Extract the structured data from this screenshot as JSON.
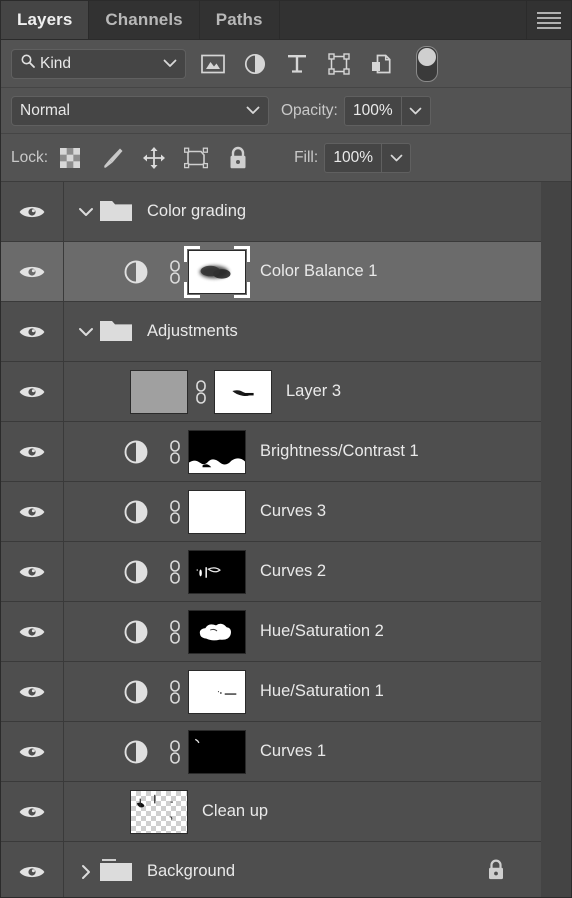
{
  "panel": {
    "tabs": [
      {
        "label": "Layers",
        "active": true
      },
      {
        "label": "Channels",
        "active": false
      },
      {
        "label": "Paths",
        "active": false
      }
    ],
    "menu_icon": "hamburger-menu-icon"
  },
  "filter": {
    "kind_label": "Kind",
    "search_icon": "search-icon",
    "chevron": "chevron-down-icon",
    "icons": [
      "pixel-layer-filter-icon",
      "adjustment-layer-filter-icon",
      "type-layer-filter-icon",
      "shape-layer-filter-icon",
      "smart-object-filter-icon",
      "filter-toggle-switch"
    ]
  },
  "blend": {
    "mode": "Normal",
    "opacity_label": "Opacity:",
    "opacity_value": "100%"
  },
  "lock": {
    "label": "Lock:",
    "fill_label": "Fill:",
    "fill_value": "100%",
    "icons": [
      "lock-transparent-pixels-icon",
      "lock-image-pixels-icon",
      "lock-position-icon",
      "lock-artboard-nesting-icon",
      "lock-all-icon"
    ]
  },
  "colors": {
    "panel_bg": "#535353",
    "row_bg": "#4e4e4e",
    "row_selected_bg": "#6b6b6b",
    "tab_active_bg": "#454545",
    "tabbar_bg": "#323232",
    "text": "#e9e9e9",
    "gutter": "#444444"
  },
  "layers": [
    {
      "name": "Color grading",
      "type": "group",
      "visible": true,
      "selected": false,
      "expanded": true,
      "indent": 0,
      "locked": false
    },
    {
      "name": "Color Balance 1",
      "type": "adjustment",
      "visible": true,
      "selected": true,
      "indent": 1,
      "linked": true,
      "mask": "blurred-dark-blob-on-white",
      "locked": false
    },
    {
      "name": "Adjustments",
      "type": "group",
      "visible": true,
      "selected": false,
      "expanded": true,
      "indent": 0,
      "locked": false
    },
    {
      "name": "Layer 3",
      "type": "pixel",
      "visible": true,
      "selected": false,
      "indent": 1,
      "linked": true,
      "mask": "white-with-small-dark-streak",
      "locked": false
    },
    {
      "name": "Brightness/Contrast 1",
      "type": "adjustment",
      "visible": true,
      "selected": false,
      "indent": 1,
      "linked": true,
      "mask": "black-with-white-bottom-band",
      "locked": false
    },
    {
      "name": "Curves 3",
      "type": "adjustment",
      "visible": true,
      "selected": false,
      "indent": 1,
      "linked": true,
      "mask": "all-white",
      "locked": false
    },
    {
      "name": "Curves 2",
      "type": "adjustment",
      "visible": true,
      "selected": false,
      "indent": 1,
      "linked": true,
      "mask": "black-with-small-white-marks",
      "locked": false
    },
    {
      "name": "Hue/Saturation 2",
      "type": "adjustment",
      "visible": true,
      "selected": false,
      "indent": 1,
      "linked": true,
      "mask": "black-with-white-blob",
      "locked": false
    },
    {
      "name": "Hue/Saturation 1",
      "type": "adjustment",
      "visible": true,
      "selected": false,
      "indent": 1,
      "linked": true,
      "mask": "white-with-tiny-dark-marks",
      "locked": false
    },
    {
      "name": "Curves 1",
      "type": "adjustment",
      "visible": true,
      "selected": false,
      "indent": 1,
      "linked": true,
      "mask": "black-with-tiny-white-mark",
      "locked": false
    },
    {
      "name": "Clean up",
      "type": "pixel",
      "visible": true,
      "selected": false,
      "indent": 1,
      "linked": false,
      "mask": null,
      "thumbnail": "transparent-checkerboard-with-marks",
      "locked": false
    },
    {
      "name": "Background",
      "type": "group",
      "visible": true,
      "selected": false,
      "expanded": false,
      "indent": 0,
      "locked": true
    }
  ]
}
